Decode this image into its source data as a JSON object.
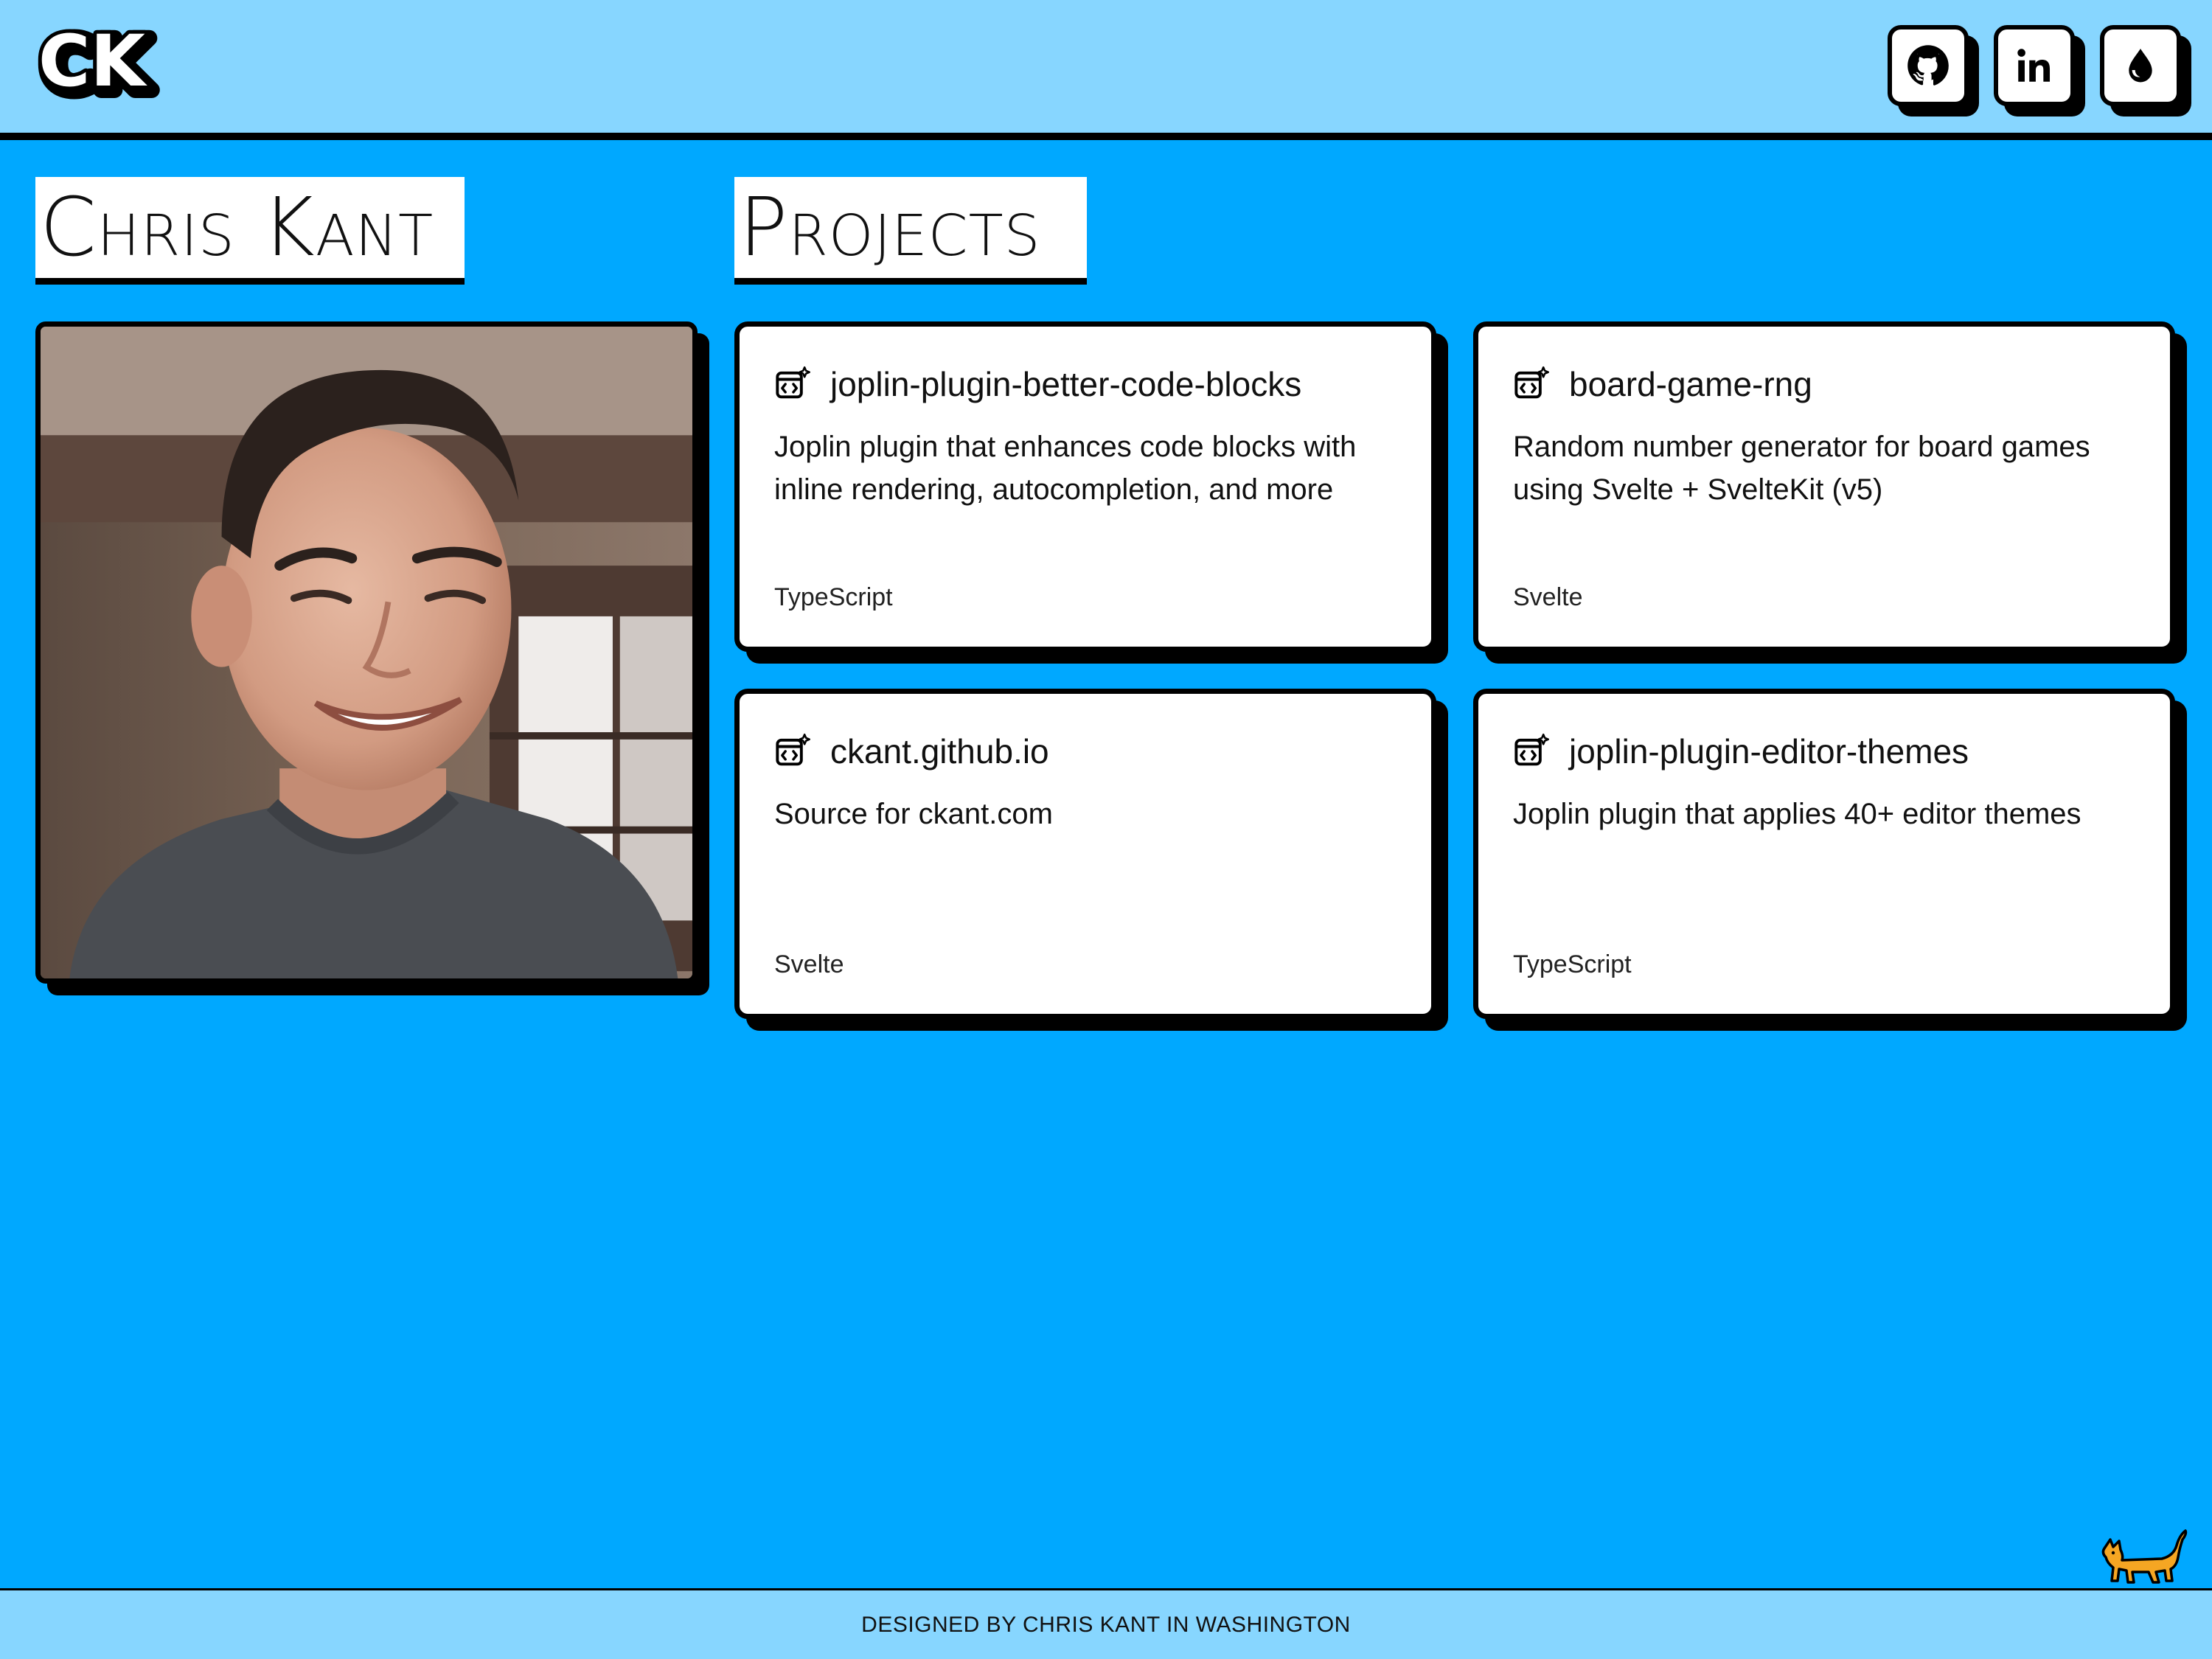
{
  "header": {
    "logo_text": "CK",
    "social": [
      {
        "name": "github",
        "icon": "github-icon"
      },
      {
        "name": "linkedin",
        "icon": "linkedin-icon",
        "label": "in"
      },
      {
        "name": "drop",
        "icon": "water-drop-icon"
      }
    ]
  },
  "profile": {
    "name": "Chris Kant",
    "photo_alt": "Portrait of Chris Kant"
  },
  "projects": {
    "heading": "Projects",
    "items": [
      {
        "title": "joplin-plugin-better-code-blocks",
        "description": "Joplin plugin that enhances code blocks with inline rendering, autocompletion, and more",
        "language": "TypeScript",
        "icon": "code-window-sparkle-icon"
      },
      {
        "title": "board-game-rng",
        "description": "Random number generator for board games using Svelte + SvelteKit (v5)",
        "language": "Svelte",
        "icon": "code-window-sparkle-icon"
      },
      {
        "title": "ckant.github.io",
        "description": "Source for ckant.com",
        "language": "Svelte",
        "icon": "code-window-sparkle-icon"
      },
      {
        "title": "joplin-plugin-editor-themes",
        "description": "Joplin plugin that applies 40+ editor themes",
        "language": "TypeScript",
        "icon": "code-window-sparkle-icon"
      }
    ]
  },
  "footer": {
    "text": "DESIGNED BY CHRIS KANT IN WASHINGTON",
    "mascot_icon": "cat-icon"
  },
  "colors": {
    "background": "#00A8FF",
    "header_footer": "#87D6FF",
    "card": "#FFFFFF",
    "border": "#000000",
    "cat": "#F5A623"
  }
}
